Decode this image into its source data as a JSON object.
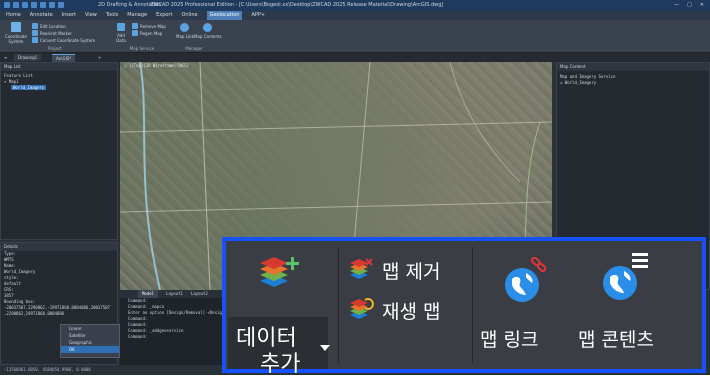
{
  "titlebar": {
    "title": "ZWCAD 2025 Professional Edition - [C:\\Users\\Bogeol.xx\\Desktop\\ZWCAD 2025 Release Material\\Drawing\\ArcGIS.dwg]",
    "workspace": "2D Drafting & Annotation",
    "window_controls": [
      "—",
      "□",
      "✕"
    ]
  },
  "menubar": {
    "items": [
      "Home",
      "Annotate",
      "Insert",
      "View",
      "Tools",
      "Manage",
      "Export",
      "Online",
      "Geolocation",
      "APP+"
    ],
    "active": "Geolocation"
  },
  "ribbon": {
    "coordinate_system": "Coordinate System",
    "edit_location": "Edit Location",
    "reorient_marker": "Reorient Marker",
    "convert_coordinate_system": "Convert Coordinate System",
    "group_project": "Project",
    "add_data": "Add Data",
    "remove_map": "Remove Map",
    "regen_map": "Regen Map",
    "group_map_service": "Map Service",
    "map_link": "Map Link",
    "map_contents": "Map Contents",
    "group_manager": "Manager"
  },
  "doc_tabs": {
    "menu_icon": "hamburger-icon",
    "tabs": [
      "Drawing1",
      "ArcGIS*"
    ],
    "add": "+"
  },
  "map_list": {
    "title": "Map List",
    "features_label": "Feature List",
    "tree": [
      "Map1",
      "World_Imagery"
    ]
  },
  "details": {
    "title": "Details",
    "lines": [
      "Type:",
      "WMTS",
      "",
      "Name:",
      "World_Imagery",
      "",
      "style:",
      "default",
      "",
      "CRS:",
      "3857",
      "",
      "Bounding box:",
      "-20037507.2290862,-19971868.8804086,20037507",
      ".2290862,19971868.8804086"
    ]
  },
  "context_menu": {
    "items": [
      "Linear",
      "Satellite",
      "Geographic",
      "OK"
    ],
    "selected": "OK"
  },
  "map_view": {
    "label": "[-][Top][2D Wireframe][WCS]"
  },
  "map_content": {
    "title": "Map Content",
    "heading": "Map and Imagery Service",
    "item": "World_Imagery"
  },
  "command": {
    "tabs": [
      "Model",
      "Layout1",
      "Layout2"
    ],
    "lines": [
      "Command:",
      "Command: _mapco",
      "Enter an option [Design/Removal] <Design>:",
      "Command:",
      "Command:",
      "Command: _addgeoservice",
      "",
      "Command:"
    ]
  },
  "status": {
    "coords": "-11568461.0050, 4584054.9966, 0.0000"
  },
  "zoom": {
    "add_data_line1": "데이터",
    "add_data_line2": "추가",
    "remove_map": "맵 제거",
    "regen_map": "재생 맵",
    "map_link": "맵 링크",
    "map_contents": "맵 콘텐츠"
  },
  "colors": {
    "highlight_border": "#1652ff",
    "ribbon_bg": "#3a3d43",
    "accent": "#2f6fb4"
  }
}
